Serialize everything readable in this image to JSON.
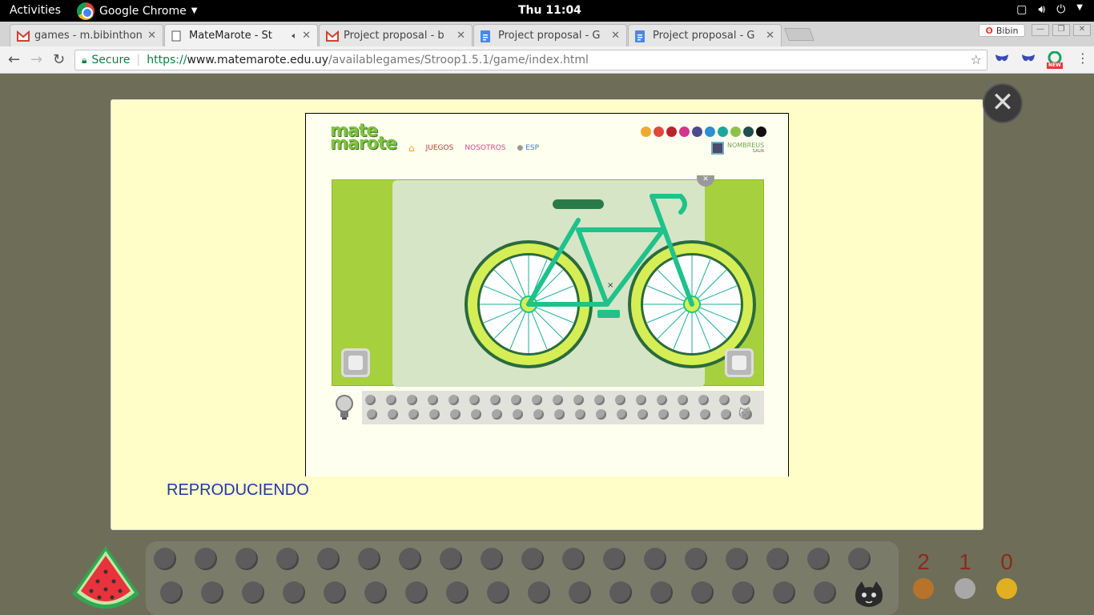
{
  "topbar": {
    "activities": "Activities",
    "app_name": "Google Chrome",
    "clock": "Thu 11:04"
  },
  "tabs": [
    {
      "title": "games - m.bibinthon",
      "icon": "gmail-icon"
    },
    {
      "title": "MateMarote - St",
      "icon": "page-icon",
      "audio": "speaker-icon"
    },
    {
      "title": "Project proposal - b",
      "icon": "gmail-icon"
    },
    {
      "title": "Project proposal - G",
      "icon": "docs-icon"
    },
    {
      "title": "Project proposal - G",
      "icon": "docs-icon"
    }
  ],
  "profile": {
    "name": "Bibin"
  },
  "address": {
    "secure_label": "Secure",
    "url_scheme": "https://",
    "url_host": "www.matemarote.edu.uy",
    "url_path": "/availablegames/Stroop1.5.1/game/index.html"
  },
  "extensions": {
    "new_badge": "NEW"
  },
  "site": {
    "logo_line1": "mate",
    "logo_line2": "marote",
    "nav_juegos": "JUEGOS",
    "nav_nosotros": "NOSOTROS",
    "nav_esp": "ESP",
    "user_name": "NOMBREUS",
    "user_exit": "SALIR",
    "theme_colors": [
      "#f0a830",
      "#e0483c",
      "#b8232f",
      "#d6338b",
      "#4a4a8c",
      "#2d8ed0",
      "#1aa89a",
      "#8bc34a",
      "#1f4f4f",
      "#111111"
    ]
  },
  "game": {
    "status": "REPRODUCIENDO",
    "bike_colors": {
      "frame": "#1ec28a",
      "tire_outer": "#2a6b3e",
      "tire": "#d6ee55",
      "seat": "#2a7a48"
    }
  },
  "scores": [
    {
      "value": "2",
      "medal": "#b8732a"
    },
    {
      "value": "1",
      "medal": "#a8a8a8"
    },
    {
      "value": "0",
      "medal": "#e0b020"
    }
  ]
}
